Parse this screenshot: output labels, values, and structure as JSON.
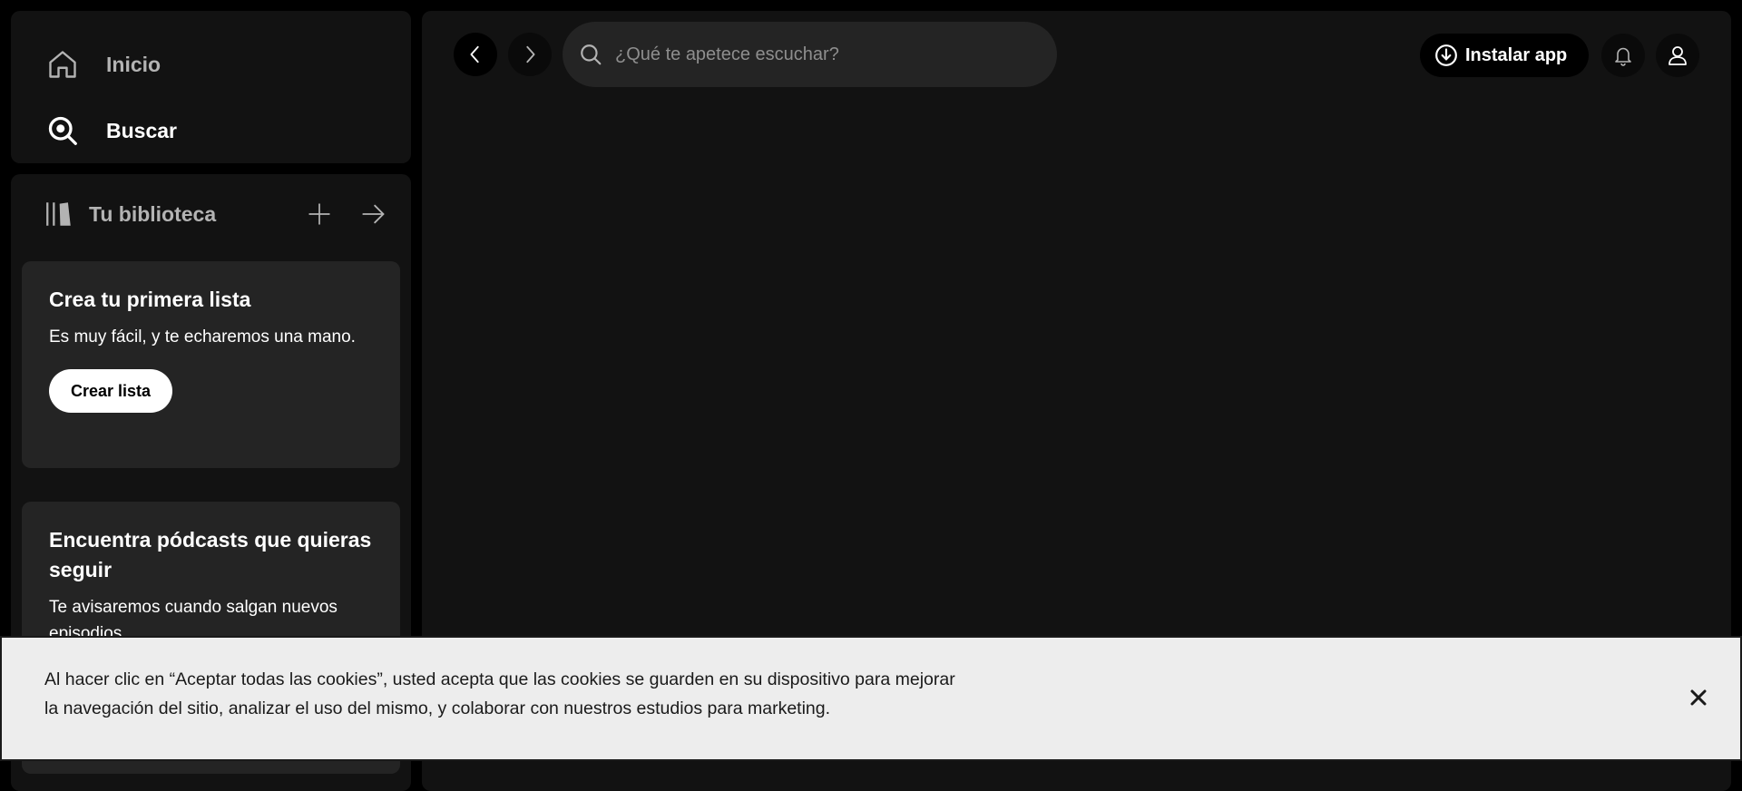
{
  "sidebar": {
    "nav": [
      {
        "label": "Inicio",
        "icon": "home-icon"
      },
      {
        "label": "Buscar",
        "icon": "search-icon"
      }
    ],
    "library": {
      "title": "Tu biblioteca",
      "cards": [
        {
          "title": "Crea tu primera lista",
          "text": "Es muy fácil, y te echaremos una mano.",
          "button": "Crear lista"
        },
        {
          "title": "Encuentra pódcasts que quieras seguir",
          "text": "Te avisaremos cuando salgan nuevos episodios."
        }
      ]
    }
  },
  "topbar": {
    "search_placeholder": "¿Qué te apetece escuchar?",
    "install_label": "Instalar app"
  },
  "cookie_banner": {
    "text": "Al hacer clic en “Aceptar todas las cookies”, usted acepta que las cookies se guarden en su dispositivo para mejorar la navegación del sitio, analizar el uso del mismo, y colaborar con nuestros estudios para marketing."
  },
  "colors": {
    "background": "#000000",
    "panel": "#121212",
    "card": "#242424",
    "text_primary": "#ffffff",
    "text_muted": "#b3b3b3",
    "banner": "#ededed"
  }
}
